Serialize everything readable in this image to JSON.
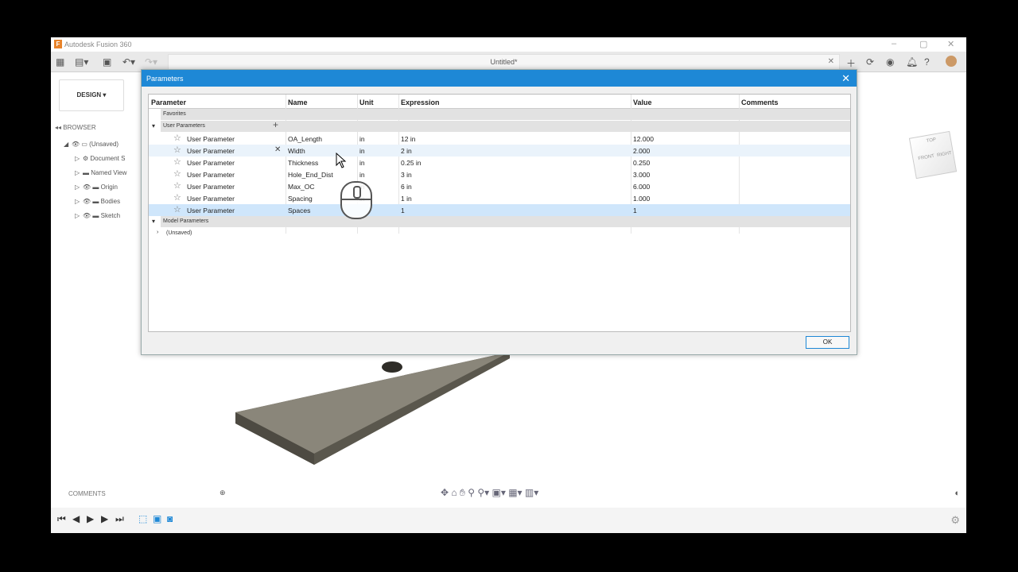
{
  "app": {
    "title": "Autodesk Fusion 360",
    "document_tab": "Untitled*",
    "workspace_button": "DESIGN",
    "browser_label": "BROWSER",
    "browser_items": [
      {
        "label": "(Unsaved)"
      },
      {
        "label": "Document S"
      },
      {
        "label": "Named View"
      },
      {
        "label": "Origin"
      },
      {
        "label": "Bodies"
      },
      {
        "label": "Sketch"
      }
    ],
    "comments_label": "COMMENTS",
    "accent": "#1e88d6"
  },
  "dialog": {
    "title": "Parameters",
    "columns": {
      "parameter": "Parameter",
      "name": "Name",
      "unit": "Unit",
      "expression": "Expression",
      "value": "Value",
      "comments": "Comments"
    },
    "favorites_label": "Favorites",
    "user_params_label": "User Parameters",
    "model_params_label": "Model Parameters",
    "unsaved_label": "(Unsaved)",
    "rows": [
      {
        "type": "User Parameter",
        "name": "OA_Length",
        "unit": "in",
        "expression": "12 in",
        "value": "12.000",
        "comment": ""
      },
      {
        "type": "User Parameter",
        "name": "Width",
        "unit": "in",
        "expression": "2 in",
        "value": "2.000",
        "comment": ""
      },
      {
        "type": "User Parameter",
        "name": "Thickness",
        "unit": "in",
        "expression": "0.25 in",
        "value": "0.250",
        "comment": ""
      },
      {
        "type": "User Parameter",
        "name": "Hole_End_Dist",
        "unit": "in",
        "expression": "3 in",
        "value": "3.000",
        "comment": ""
      },
      {
        "type": "User Parameter",
        "name": "Max_OC",
        "unit": "in",
        "expression": "6 in",
        "value": "6.000",
        "comment": ""
      },
      {
        "type": "User Parameter",
        "name": "Spacing",
        "unit": "in",
        "expression": "1 in",
        "value": "1.000",
        "comment": ""
      },
      {
        "type": "User Parameter",
        "name": "Spaces",
        "unit": "",
        "expression": "1",
        "value": "1",
        "comment": ""
      }
    ],
    "ok_label": "OK"
  }
}
